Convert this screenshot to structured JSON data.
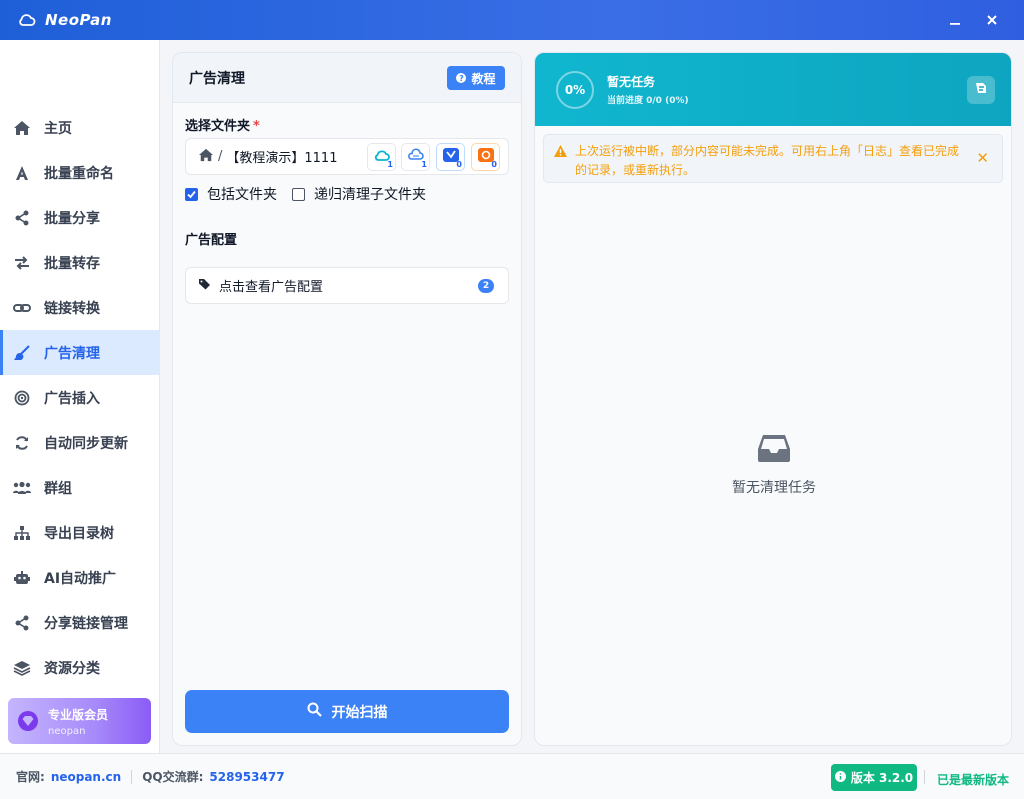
{
  "app": {
    "title": "NeoPan"
  },
  "sidebar": {
    "items": [
      {
        "label": "主页",
        "icon": "home-icon"
      },
      {
        "label": "批量重命名",
        "icon": "font-icon"
      },
      {
        "label": "批量分享",
        "icon": "share-icon"
      },
      {
        "label": "批量转存",
        "icon": "transfer-icon"
      },
      {
        "label": "链接转换",
        "icon": "link-icon"
      },
      {
        "label": "广告清理",
        "icon": "broom-icon",
        "active": true
      },
      {
        "label": "广告插入",
        "icon": "target-icon"
      },
      {
        "label": "自动同步更新",
        "icon": "sync-icon"
      },
      {
        "label": "群组",
        "icon": "users-icon"
      },
      {
        "label": "导出目录树",
        "icon": "sitemap-icon"
      },
      {
        "label": "AI自动推广",
        "icon": "robot-icon"
      },
      {
        "label": "分享链接管理",
        "icon": "share-icon"
      },
      {
        "label": "资源分类",
        "icon": "layers-icon"
      }
    ],
    "pro": {
      "title": "专业版会员",
      "subtitle": "neopan"
    }
  },
  "left_panel": {
    "title": "广告清理",
    "tutorial_label": "教程",
    "folder_label": "选择文件夹",
    "required_mark": "*",
    "folder_path": "【教程演示】1111",
    "path_separator": "/",
    "cloud_buttons": [
      {
        "icon": "cloud-1-icon",
        "count": "1"
      },
      {
        "icon": "cloud-2-icon",
        "count": "1"
      },
      {
        "icon": "cloud-3-icon",
        "count": "0"
      },
      {
        "icon": "cloud-4-icon",
        "count": "0"
      }
    ],
    "include_folder_label": "包括文件夹",
    "include_folder_checked": true,
    "recursive_label": "递归清理子文件夹",
    "recursive_checked": false,
    "ad_config_label": "广告配置",
    "ad_config_link": "点击查看广告配置",
    "ad_config_count": "2",
    "scan_button": "开始扫描"
  },
  "right_panel": {
    "progress_text": "0%",
    "task_title": "暂无任务",
    "task_subtitle": "当前进度 0/0 (0%)",
    "warning": "上次运行被中断，部分内容可能未完成。可用右上角「日志」查看已完成的记录，或重新执行。",
    "empty_text": "暂无清理任务"
  },
  "footer": {
    "site_label": "官网:",
    "site_value": "neopan.cn",
    "qq_label": "QQ交流群:",
    "qq_value": "528953477",
    "version": "版本 3.2.0",
    "latest": "已是最新版本"
  },
  "colors": {
    "accent": "#3b82f6",
    "header": "#2f66e0",
    "teal": "#10b6cf",
    "warning": "#f59e0b",
    "success": "#10b981"
  }
}
